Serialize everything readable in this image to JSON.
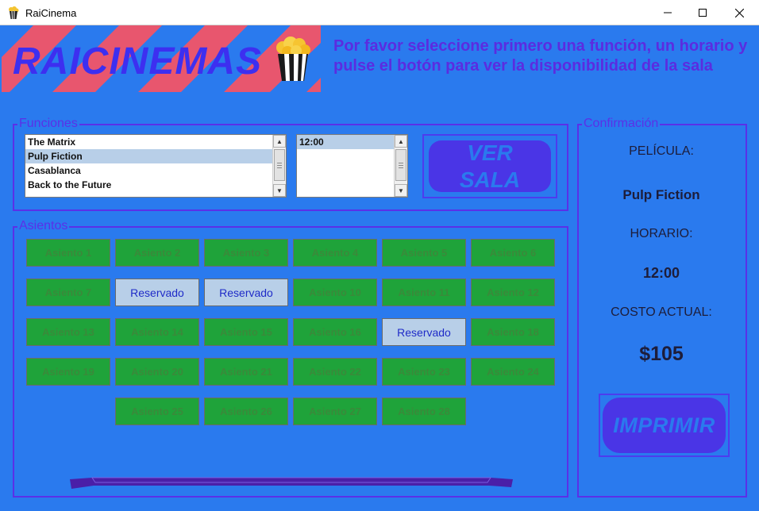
{
  "window": {
    "title": "RaiCinema"
  },
  "banner": {
    "logo_text": "RAICINEMAS",
    "instructions": "Por favor seleccione primero una función, un horario y pulse el botón para ver la disponibilidad de la sala"
  },
  "funciones": {
    "title": "Funciones",
    "movies": [
      {
        "label": "The Matrix",
        "selected": false
      },
      {
        "label": "Pulp Fiction",
        "selected": true
      },
      {
        "label": "Casablanca",
        "selected": false
      },
      {
        "label": "Back to the Future",
        "selected": false
      }
    ],
    "times": [
      {
        "label": "12:00",
        "selected": true
      }
    ],
    "ver_sala_label": "VER\nSALA"
  },
  "asientos": {
    "title": "Asientos",
    "seats": [
      {
        "label": "Asiento 1",
        "status": "free"
      },
      {
        "label": "Asiento 2",
        "status": "free"
      },
      {
        "label": "Asiento 3",
        "status": "free"
      },
      {
        "label": "Asiento 4",
        "status": "free"
      },
      {
        "label": "Asiento 5",
        "status": "free"
      },
      {
        "label": "Asiento 6",
        "status": "free"
      },
      {
        "label": "Asiento 7",
        "status": "free"
      },
      {
        "label": "Reservado",
        "status": "reserved"
      },
      {
        "label": "Reservado",
        "status": "reserved"
      },
      {
        "label": "Asiento 10",
        "status": "free"
      },
      {
        "label": "Asiento 11",
        "status": "free"
      },
      {
        "label": "Asiento 12",
        "status": "free"
      },
      {
        "label": "Asiento 13",
        "status": "free"
      },
      {
        "label": "Asiento 14",
        "status": "free"
      },
      {
        "label": "Asiento 15",
        "status": "free"
      },
      {
        "label": "Asiento 16",
        "status": "free"
      },
      {
        "label": "Reservado",
        "status": "reserved"
      },
      {
        "label": "Asiento 18",
        "status": "free"
      },
      {
        "label": "Asiento 19",
        "status": "free"
      },
      {
        "label": "Asiento 20",
        "status": "free"
      },
      {
        "label": "Asiento 21",
        "status": "free"
      },
      {
        "label": "Asiento 22",
        "status": "free"
      },
      {
        "label": "Asiento 23",
        "status": "free"
      },
      {
        "label": "Asiento 24",
        "status": "free"
      },
      {
        "label": "Asiento 25",
        "status": "free"
      },
      {
        "label": "Asiento 26",
        "status": "free"
      },
      {
        "label": "Asiento 27",
        "status": "free"
      },
      {
        "label": "Asiento 28",
        "status": "free"
      }
    ]
  },
  "confirmacion": {
    "title": "Confirmación",
    "pelicula_label": "PELÍCULA:",
    "pelicula_value": "Pulp Fiction",
    "horario_label": "HORARIO:",
    "horario_value": "12:00",
    "costo_label": "COSTO ACTUAL:",
    "costo_value": "$105",
    "imprimir_label": "IMPRIMIR"
  },
  "colors": {
    "background": "#2a7aee",
    "accent_purple": "#4a35e6",
    "seat_free": "#1fa33a",
    "seat_reserved": "#b8cfe8",
    "stripe_pink": "#e8566e"
  },
  "icons": [
    "popcorn-icon",
    "minimize-icon",
    "maximize-icon",
    "close-icon"
  ]
}
